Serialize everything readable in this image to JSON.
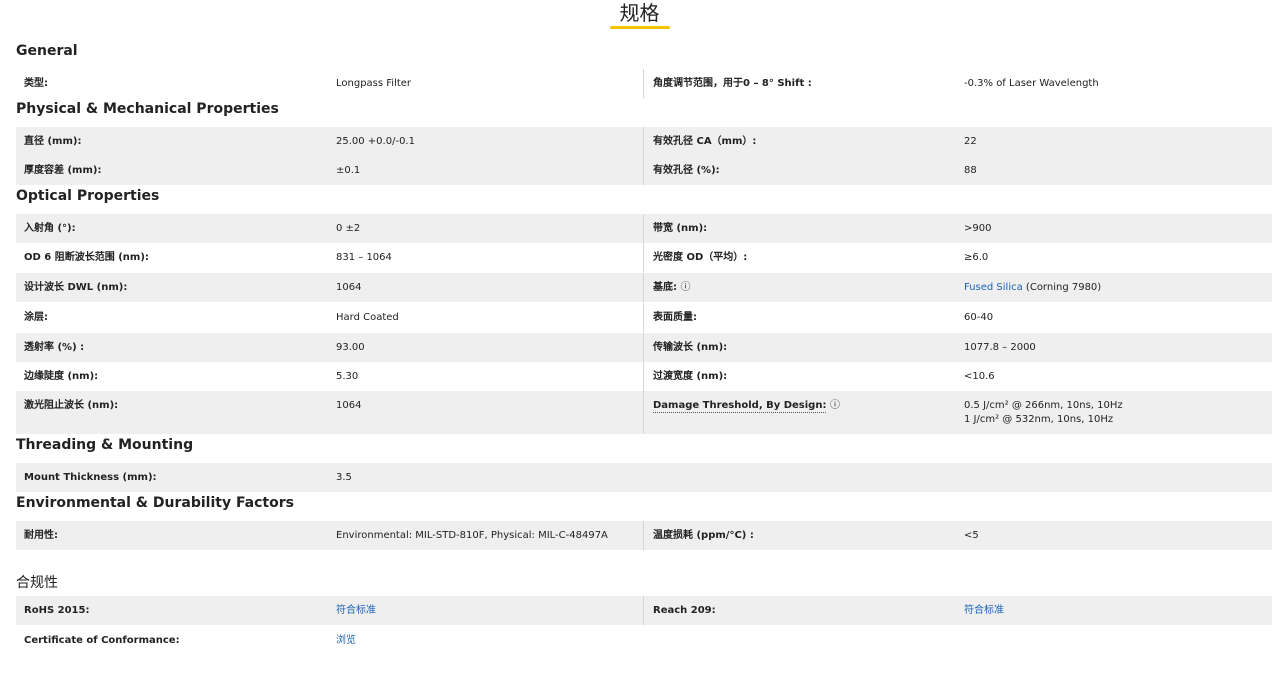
{
  "page_title": "规格",
  "sections": {
    "general": "General",
    "physical": "Physical & Mechanical Properties",
    "optical": "Optical Properties",
    "threading": "Threading & Mounting",
    "environmental": "Environmental & Durability Factors",
    "compliance": "合规性"
  },
  "general": {
    "type_label": "类型:",
    "type_value": "Longpass Filter",
    "angle_label": "角度调节范围，用于0 – 8° Shift :",
    "angle_value": "-0.3% of Laser Wavelength"
  },
  "physical": {
    "diameter_label": "直径 (mm):",
    "diameter_value": "25.00 +0.0/-0.1",
    "ca_label": "有效孔径 CA（mm）:",
    "ca_value": "22",
    "thickness_tol_label": "厚度容差 (mm):",
    "thickness_tol_value": "±0.1",
    "ca_pct_label": "有效孔径 (%):",
    "ca_pct_value": "88"
  },
  "optical": {
    "aoi_label": "入射角 (°):",
    "aoi_value": "0 ±2",
    "bandwidth_label": "带宽 (nm):",
    "bandwidth_value": ">900",
    "od6_label": "OD 6 阻断波长范围 (nm):",
    "od6_value": "831 – 1064",
    "od_label": "光密度 OD（平均）:",
    "od_value": "≥6.0",
    "dwl_label": "设计波长 DWL (nm):",
    "dwl_value": "1064",
    "substrate_label": "基底:",
    "substrate_info": "ⓘ",
    "substrate_link": "Fused Silica",
    "substrate_value": " (Corning 7980)",
    "coating_label": "涂层:",
    "coating_value": "Hard Coated",
    "surface_label": "表面质量:",
    "surface_value": "60-40",
    "transmission_label": "透射率 (%) :",
    "transmission_value": "93.00",
    "transmission_wl_label": "传输波长 (nm):",
    "transmission_wl_value": "1077.8 – 2000",
    "edge_label": "边缘陡度 (nm):",
    "edge_value": "5.30",
    "transition_label": "过渡宽度 (nm):",
    "transition_value": "<10.6",
    "laser_block_label": "激光阻止波长 (nm):",
    "laser_block_value": "1064",
    "damage_label": "Damage Threshold, By Design:",
    "damage_info": "ⓘ",
    "damage_value_1": "0.5 J/cm² @ 266nm, 10ns, 10Hz",
    "damage_value_2": "1 J/cm² @ 532nm, 10ns, 10Hz"
  },
  "threading": {
    "mount_label": "Mount Thickness (mm):",
    "mount_value": "3.5"
  },
  "environmental": {
    "durability_label": "耐用性:",
    "durability_value": "Environmental: MIL-STD-810F, Physical: MIL-C-48497A",
    "temp_label": "温度损耗 (ppm/°C) :",
    "temp_value": "<5"
  },
  "compliance": {
    "rohs_label": "RoHS 2015:",
    "rohs_value": "符合标准",
    "reach_label": "Reach 209:",
    "reach_value": "符合标准",
    "coc_label": "Certificate of Conformance:",
    "coc_value": "浏览"
  },
  "colors": {
    "accent_underline": "#f4c400",
    "link": "#1a62b5",
    "row_shade": "#efefef"
  }
}
